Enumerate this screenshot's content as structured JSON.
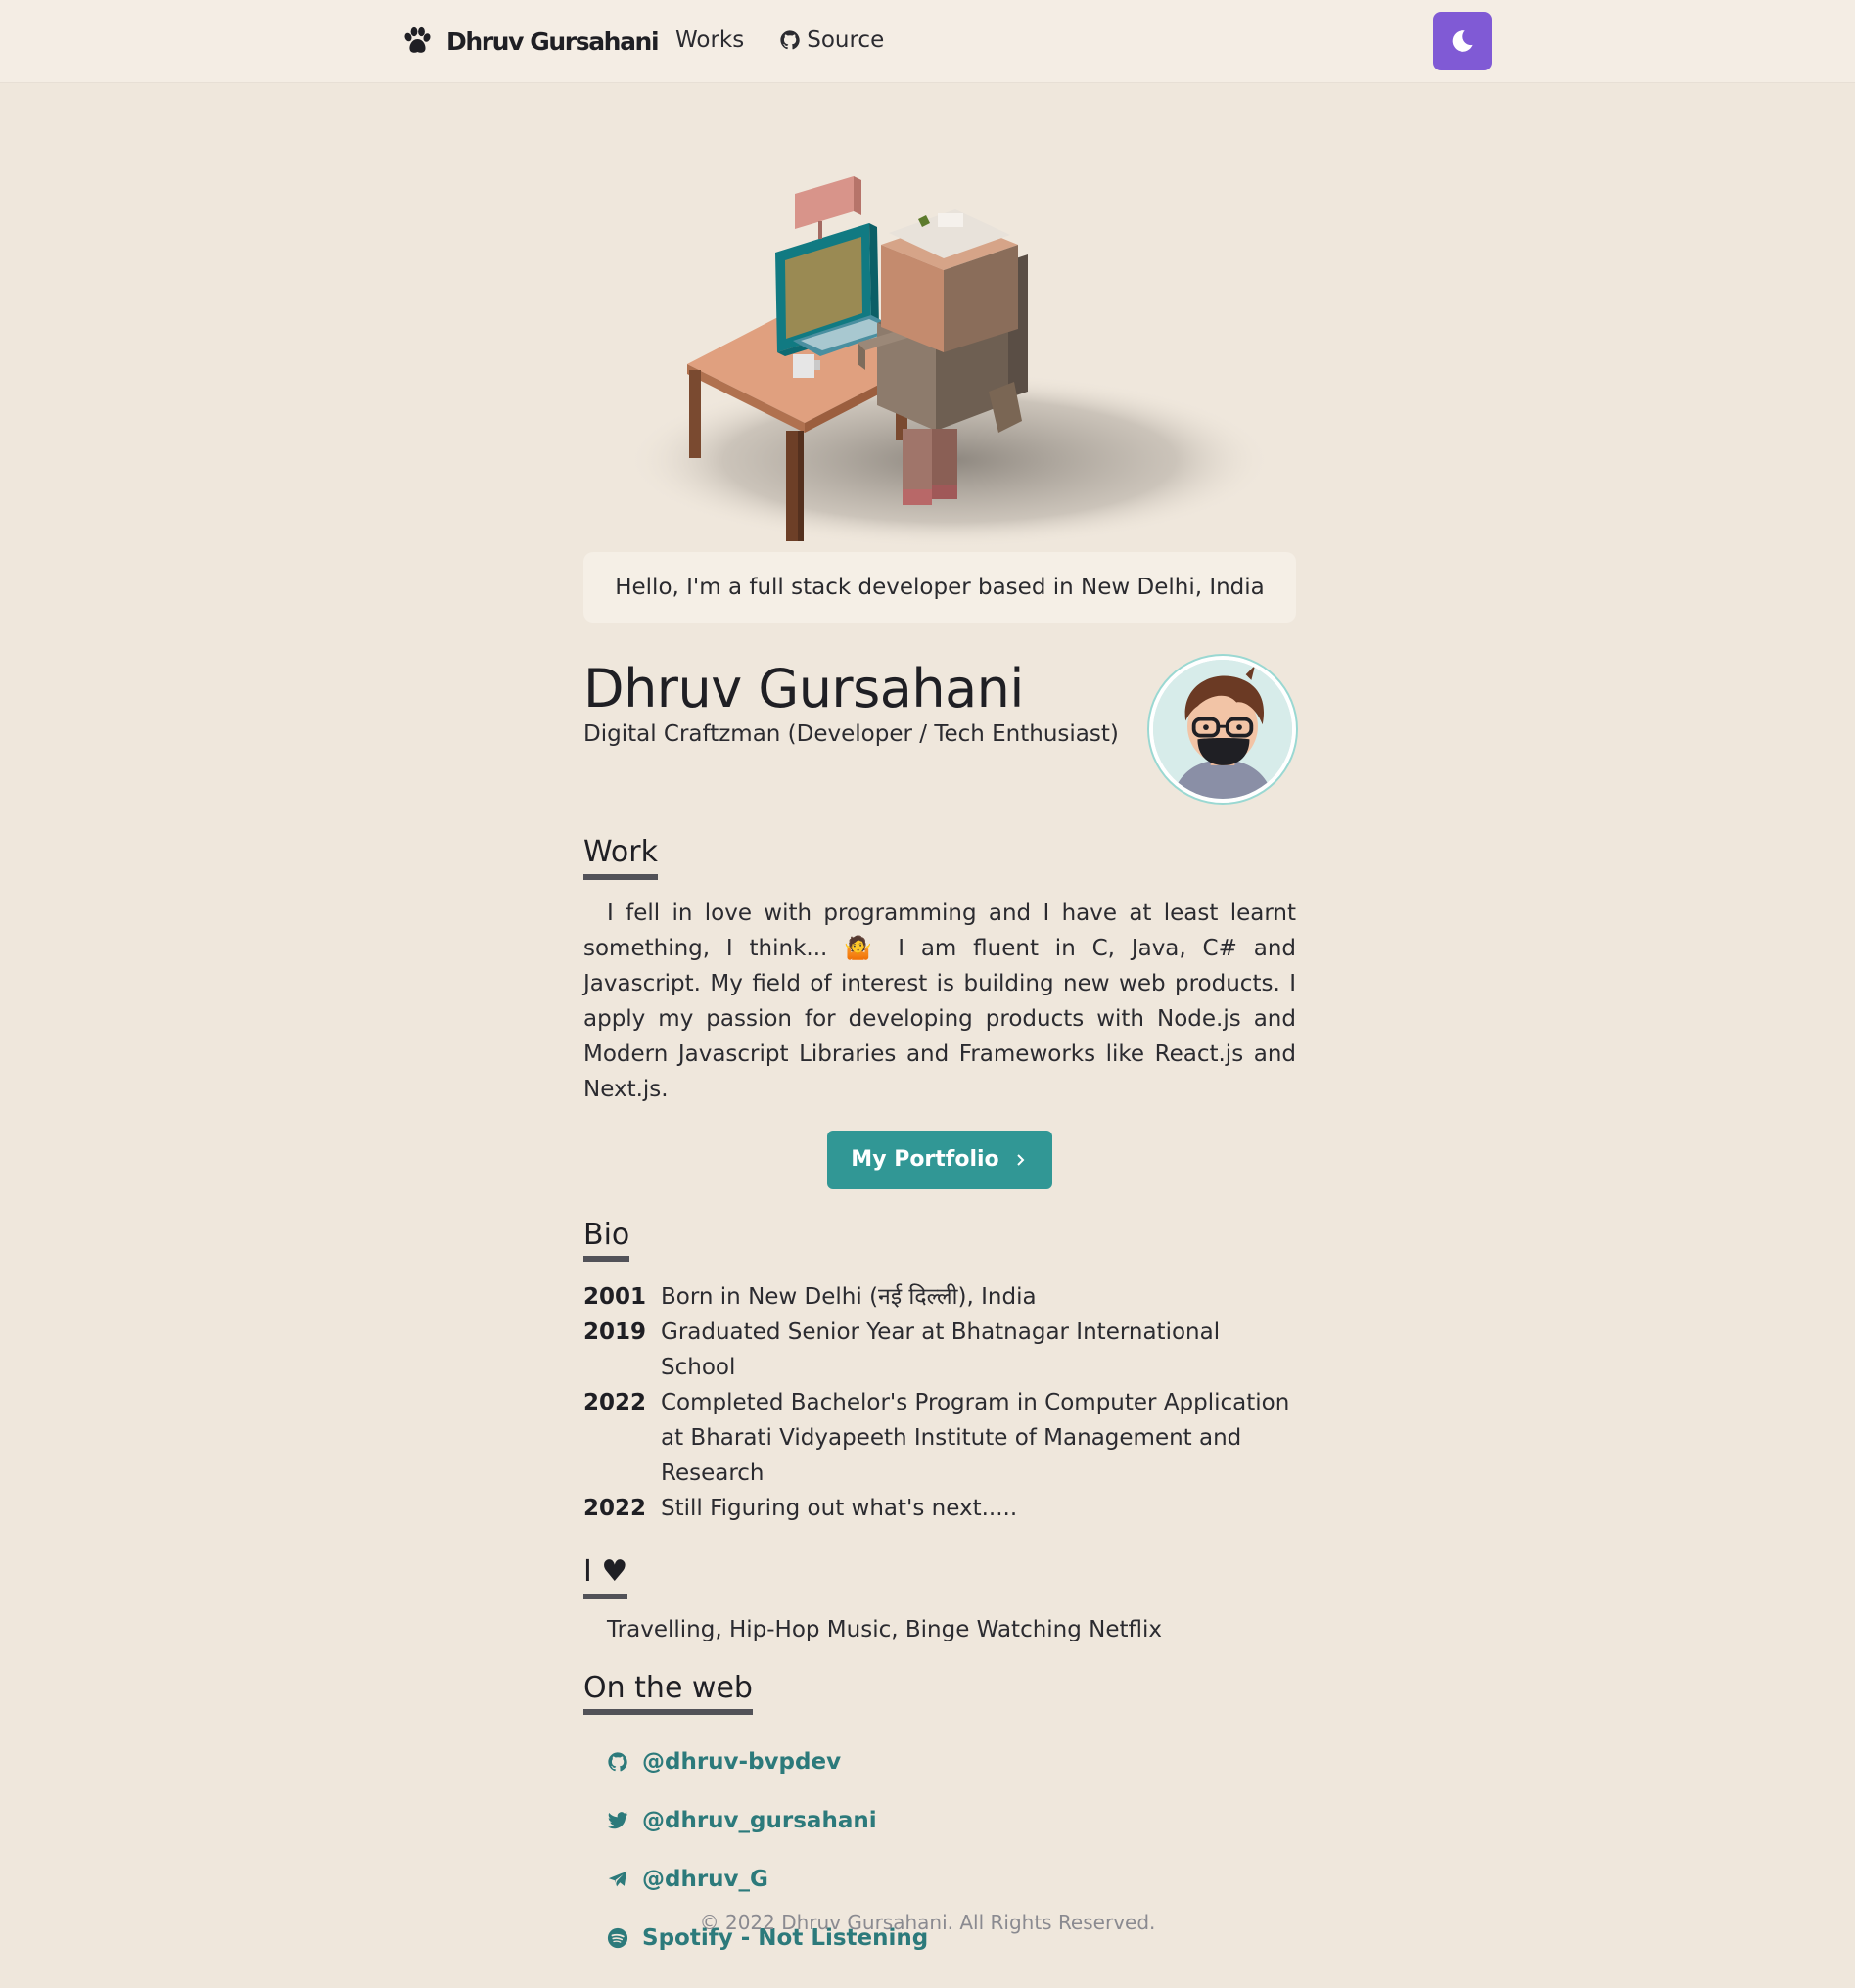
{
  "nav": {
    "brand": "Dhruv Gursahani",
    "links": [
      {
        "label": "Works",
        "icon": ""
      },
      {
        "label": "Source",
        "icon": "github-icon"
      }
    ],
    "theme_toggle_icon": "moon-icon",
    "accent": "#805ad5"
  },
  "hero": {
    "greeting": "Hello, I'm a full stack developer based in New Delhi, India"
  },
  "profile": {
    "name": "Dhruv Gursahani",
    "role": "Digital Craftzman (Developer / Tech Enthusiast)"
  },
  "work": {
    "title": "Work",
    "text": "I fell in love with programming and I have at least learnt something, I think... 🤷 I am fluent in C, Java, C# and Javascript. My field of interest is building new web products. I apply my passion for developing products with Node.js and Modern Javascript Libraries and Frameworks like React.js and Next.js.",
    "button_label": "My Portfolio",
    "button_color": "#319795"
  },
  "bio": {
    "title": "Bio",
    "entries": [
      {
        "year": "2001",
        "text": "Born in New Delhi (नई दिल्ली), India"
      },
      {
        "year": "2019",
        "text": "Graduated Senior Year at Bhatnagar International School"
      },
      {
        "year": "2022",
        "text": "Completed Bachelor's Program in Computer Application at Bharati Vidyapeeth Institute of Management and Research"
      },
      {
        "year": "2022",
        "text": "Still Figuring out what's next....."
      }
    ]
  },
  "loves": {
    "title": "I ♥",
    "text": "Travelling, Hip-Hop Music, Binge Watching Netflix"
  },
  "web": {
    "title": "On the web",
    "links": [
      {
        "label": "@dhruv-bvpdev",
        "icon": "github-icon"
      },
      {
        "label": "@dhruv_gursahani",
        "icon": "twitter-icon"
      },
      {
        "label": "@dhruv_G",
        "icon": "telegram-icon"
      },
      {
        "label": "Spotify - Not Listening",
        "icon": "spotify-icon"
      }
    ],
    "link_color": "#2c7a7b"
  },
  "footer": {
    "text": "© 2022 Dhruv Gursahani. All Rights Reserved."
  }
}
